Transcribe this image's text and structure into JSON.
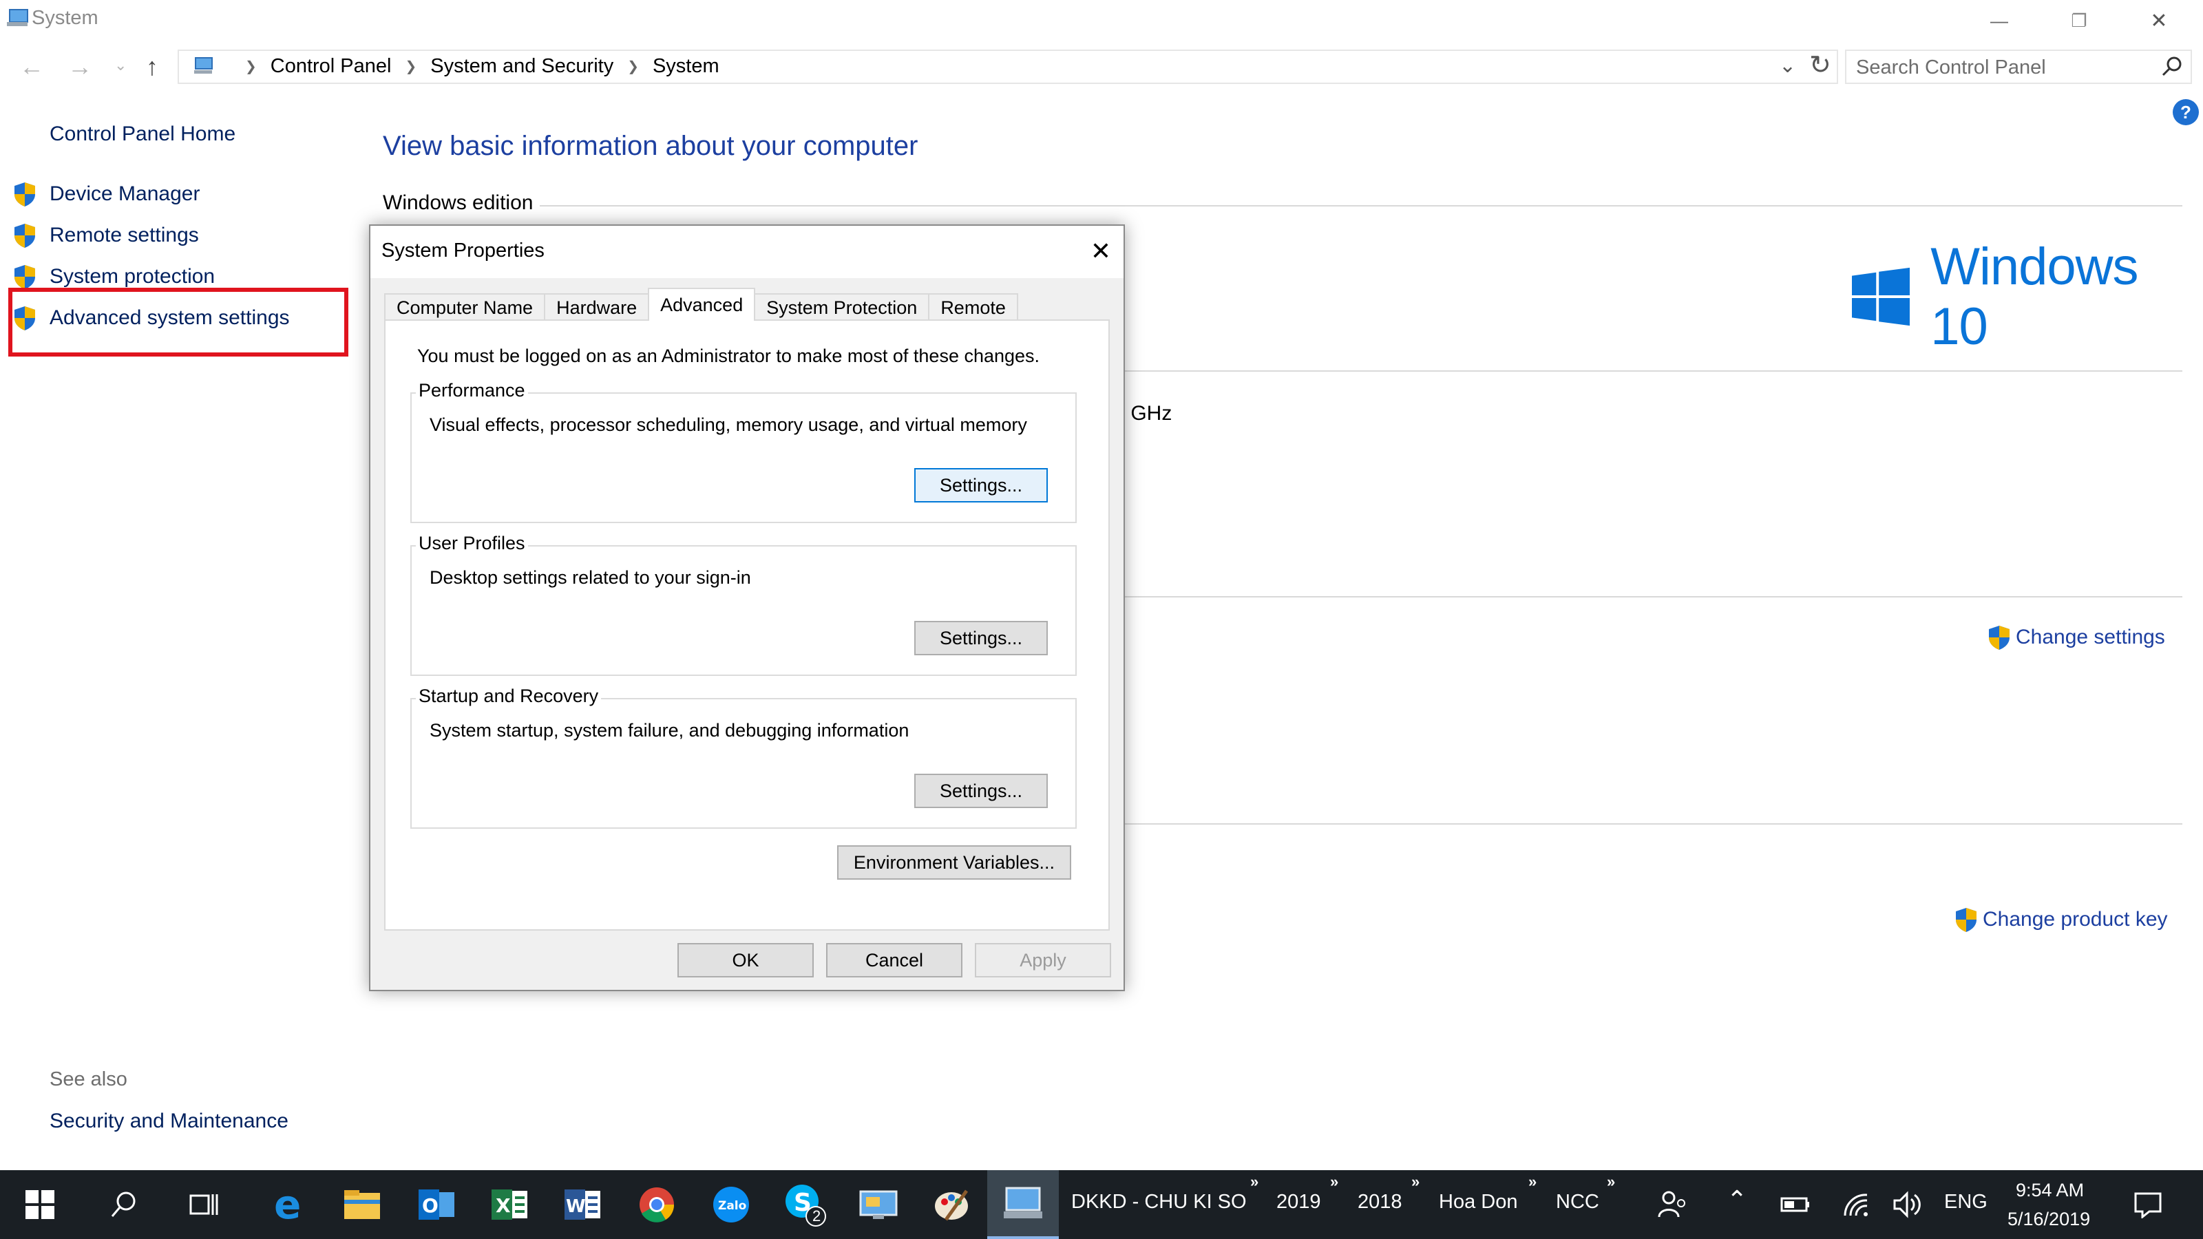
{
  "window": {
    "title": "System",
    "minimize_glyph": "—",
    "restore_glyph": "❐",
    "close_glyph": "✕"
  },
  "address_bar": {
    "crumbs": [
      "Control Panel",
      "System and Security",
      "System"
    ],
    "search_placeholder": "Search Control Panel"
  },
  "left_nav": {
    "home": "Control Panel Home",
    "links": [
      "Device Manager",
      "Remote settings",
      "System protection",
      "Advanced system settings"
    ],
    "see_also_heading": "See also",
    "see_also_link": "Security and Maintenance"
  },
  "main": {
    "title": "View basic information about your computer",
    "windows_edition": "Windows edition",
    "logo_text": "Windows 10",
    "partial_text": ") GHz",
    "change_settings": "Change settings",
    "change_product_key": "Change product key"
  },
  "dialog": {
    "title": "System Properties",
    "tabs": [
      "Computer Name",
      "Hardware",
      "Advanced",
      "System Protection",
      "Remote"
    ],
    "active_tab": "Advanced",
    "admin_note": "You must be logged on as an Administrator to make most of these changes.",
    "groups": [
      {
        "title": "Performance",
        "desc": "Visual effects, processor scheduling, memory usage, and virtual memory",
        "button": "Settings..."
      },
      {
        "title": "User Profiles",
        "desc": "Desktop settings related to your sign-in",
        "button": "Settings..."
      },
      {
        "title": "Startup and Recovery",
        "desc": "System startup, system failure, and debugging information",
        "button": "Settings..."
      }
    ],
    "env_button": "Environment Variables...",
    "ok": "OK",
    "cancel": "Cancel",
    "apply": "Apply"
  },
  "taskbar": {
    "apps": [
      "windows-start",
      "search",
      "task-view",
      "edge",
      "file-explorer",
      "outlook",
      "excel",
      "word",
      "chrome",
      "zalo",
      "skype",
      "remote-desktop",
      "paint",
      "system"
    ],
    "skype_badge": "2",
    "toolbars": [
      "DKKD - CHU KI SO",
      "2019",
      "2018",
      "Hoa Don",
      "NCC"
    ],
    "chevron": "»",
    "language": "ENG",
    "time": "9:54 AM",
    "date": "5/16/2019"
  },
  "colors": {
    "link": "#1c3fa0",
    "nav_text": "#00205e",
    "highlight": "#e0141e",
    "taskbar": "#1a1f24",
    "windows_blue": "#0a74d8"
  }
}
